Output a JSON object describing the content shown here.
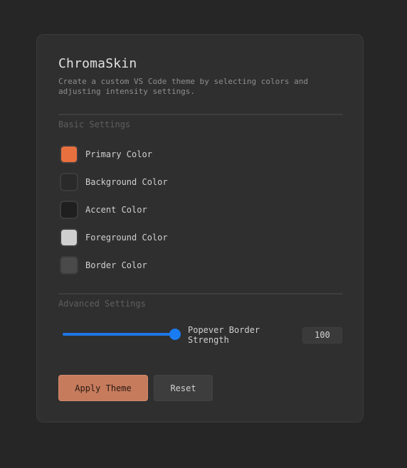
{
  "app": {
    "title": "ChromaSkin",
    "subtitle": "Create a custom VS Code theme by selecting colors and adjusting intensity settings."
  },
  "basic_settings": {
    "heading": "Basic Settings",
    "colors": [
      {
        "label": "Primary Color",
        "color": "#e8703f"
      },
      {
        "label": "Background Color",
        "color": "#2a2a2a"
      },
      {
        "label": "Accent Color",
        "color": "#1f1f1f"
      },
      {
        "label": "Foreground Color",
        "color": "#cfcfcf"
      },
      {
        "label": "Border Color",
        "color": "#4a4a4a"
      }
    ]
  },
  "advanced_settings": {
    "heading": "Advanced Settings",
    "slider": {
      "label": "Popever Border Strength",
      "value": "100",
      "fraction": 1.0
    }
  },
  "actions": {
    "apply_label": "Apply Theme",
    "reset_label": "Reset"
  },
  "theme": {
    "accent": "#c67b5c",
    "slider_accent": "#1e77e6"
  }
}
